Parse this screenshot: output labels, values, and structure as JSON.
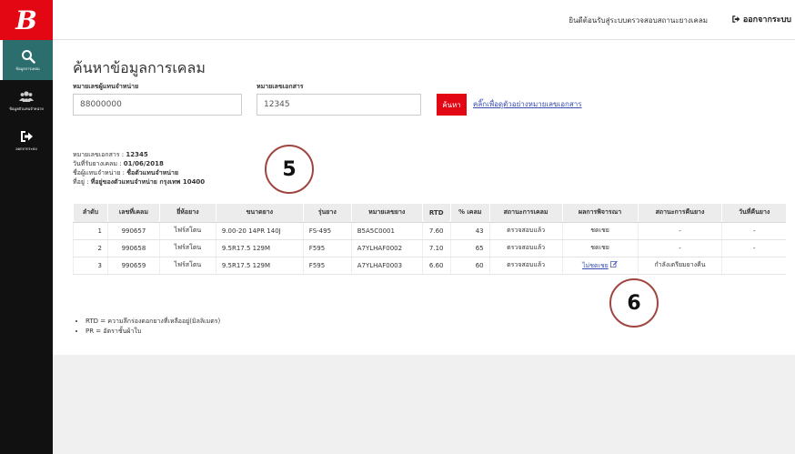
{
  "brand": {
    "logo_letter": "B",
    "accent": "#e30613",
    "sidebar_bg": "#111111",
    "active_bg": "#2c6e6e"
  },
  "sidebar": {
    "items": [
      {
        "label": "ข้อมูลการเคลม",
        "icon": "search-icon",
        "active": true
      },
      {
        "label": "ข้อมูลตัวแทนจำหน่าย",
        "icon": "users-icon",
        "active": false
      },
      {
        "label": "ออกจากระบบ",
        "icon": "logout-icon",
        "active": false
      }
    ]
  },
  "topbar": {
    "welcome": "ยินดีต้อนรับสู่ระบบตรวจสอบสถานะยางเคลม",
    "logout": "ออกจากระบบ"
  },
  "page": {
    "title": "ค้นหาข้อมูลการเคลม"
  },
  "search": {
    "dealer_label": "หมายเลขผู้แทนจำหน่าย",
    "dealer_value": "88000000",
    "doc_label": "หมายเลขเอกสาร",
    "doc_value": "12345",
    "button": "ค้นหา",
    "example_link": "คลิ๊กเพื่อดูตัวอย่างหมายเลขเอกสาร"
  },
  "info": {
    "doc_label": "หมายเลขเอกสาร : ",
    "doc_value": "12345",
    "date_label": "วันที่รับยางเคลม : ",
    "date_value": "01/06/2018",
    "dealer_label": "ชื่อผู้แทนจำหน่าย : ",
    "dealer_value": "ชื่อตัวแทนจำหน่าย",
    "address_label": "ที่อยู่ : ",
    "address_value": "ที่อยู่ของตัวแทนจำหน่าย กรุงเทพ 10400"
  },
  "markers": {
    "five": "5",
    "six": "6"
  },
  "table": {
    "headers": [
      "ลำดับ",
      "เลขที่เคลม",
      "ยี่ห้อยาง",
      "ขนาดยาง",
      "รุ่นยาง",
      "หมายเลขยาง",
      "RTD",
      "% เคลม",
      "สถานะการเคลม",
      "ผลการพิจารณา",
      "สถานะการคืนยาง",
      "วันที่คืนยาง"
    ],
    "rows": [
      [
        "1",
        "990657",
        "ไฟร์สโตน",
        "9.00-20 14PR 140J",
        "FS-495",
        "B5A5C0001",
        "7.60",
        "43",
        "ตรวจสอบแล้ว",
        "ชดเชย",
        "-",
        "-"
      ],
      [
        "2",
        "990658",
        "ไฟร์สโตน",
        "9.5R17.5 129M",
        "F595",
        "A7YLHAF0002",
        "7.10",
        "65",
        "ตรวจสอบแล้ว",
        "ชดเชย",
        "-",
        "-"
      ],
      [
        "3",
        "990659",
        "ไฟร์สโตน",
        "9.5R17.5 129M",
        "F595",
        "A7YLHAF0003",
        "6.60",
        "60",
        "ตรวจสอบแล้ว",
        "ไม่ชดเชย",
        "กำลังเตรียมยางคืน",
        ""
      ]
    ]
  },
  "notes": [
    "RTD = ความลึกร่องดอกยางที่เหลืออยู่(มิลลิเมตร)",
    "PR = อัตราชั้นผ้าใบ"
  ]
}
